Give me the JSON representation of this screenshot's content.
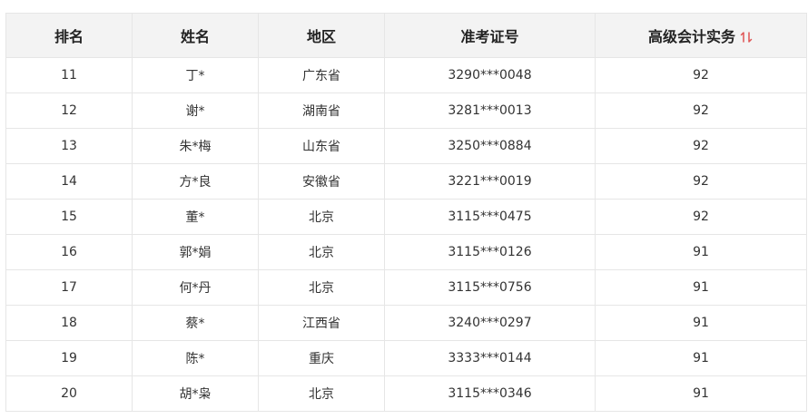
{
  "table": {
    "headers": [
      "排名",
      "姓名",
      "地区",
      "准考证号",
      "高级会计实务"
    ],
    "sort_color": "#e05555",
    "rows": [
      [
        "11",
        "丁*",
        "广东省",
        "3290***0048",
        "92"
      ],
      [
        "12",
        "谢*",
        "湖南省",
        "3281***0013",
        "92"
      ],
      [
        "13",
        "朱*梅",
        "山东省",
        "3250***0884",
        "92"
      ],
      [
        "14",
        "方*良",
        "安徽省",
        "3221***0019",
        "92"
      ],
      [
        "15",
        "董*",
        "北京",
        "3115***0475",
        "92"
      ],
      [
        "16",
        "郭*娟",
        "北京",
        "3115***0126",
        "91"
      ],
      [
        "17",
        "何*丹",
        "北京",
        "3115***0756",
        "91"
      ],
      [
        "18",
        "蔡*",
        "江西省",
        "3240***0297",
        "91"
      ],
      [
        "19",
        "陈*",
        "重庆",
        "3333***0144",
        "91"
      ],
      [
        "20",
        "胡*枭",
        "北京",
        "3115***0346",
        "91"
      ]
    ]
  }
}
